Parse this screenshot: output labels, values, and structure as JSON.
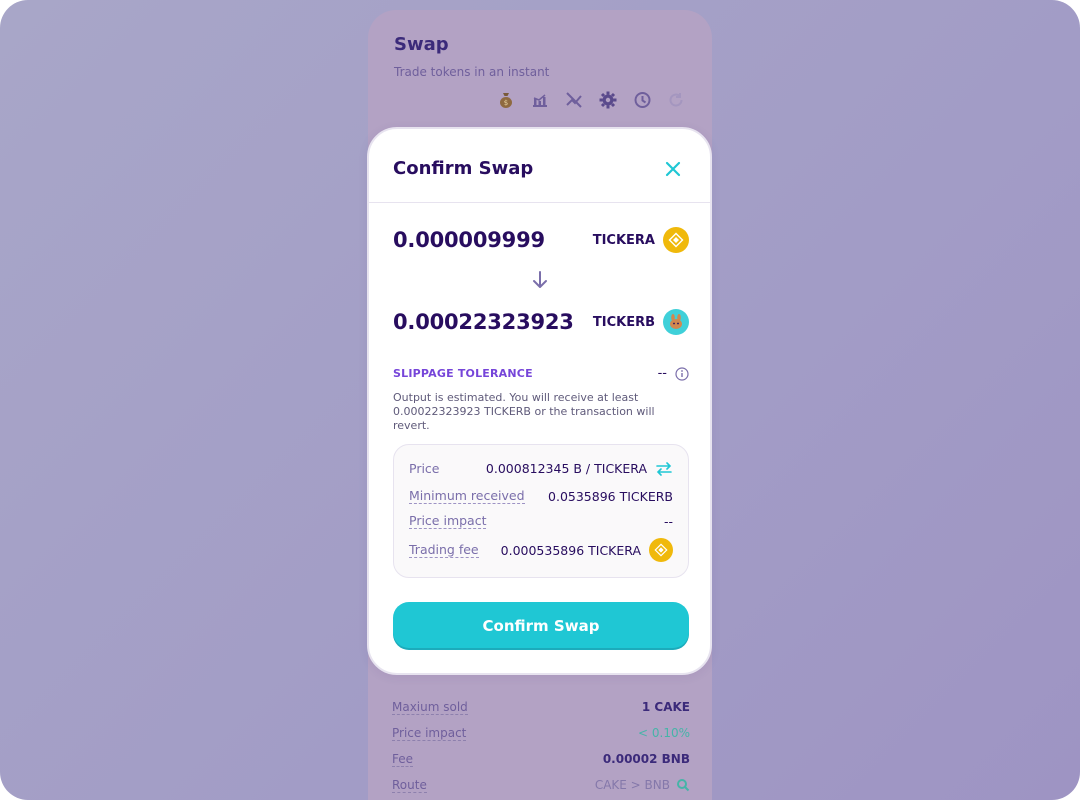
{
  "background": {
    "title": "Swap",
    "subtitle": "Trade tokens in an instant",
    "toolbar_icons": [
      "money-bag-icon",
      "chart-icon",
      "chart-off-icon",
      "gear-icon",
      "history-icon",
      "refresh-icon"
    ],
    "rows": [
      {
        "label": "Maxium sold",
        "value": "1 CAKE"
      },
      {
        "label": "Price impact",
        "value": "< 0.10%"
      },
      {
        "label": "Fee",
        "value": "0.00002 BNB"
      },
      {
        "label": "Route",
        "value": "CAKE > BNB"
      }
    ]
  },
  "modal": {
    "title": "Confirm Swap",
    "from": {
      "amount": "0.000009999",
      "symbol": "TICKERA",
      "icon": "bnb-logo-icon"
    },
    "to": {
      "amount": "0.00022323923",
      "symbol": "TICKERB",
      "icon": "cake-logo-icon"
    },
    "slippage": {
      "label": "SLIPPAGE TOLERANCE",
      "value": "--"
    },
    "note": "Output is estimated. You will receive at least 0.00022323923 TICKERB or the transaction will revert.",
    "details": {
      "price": {
        "label": "Price",
        "value": "0.000812345 B / TICKERA"
      },
      "minimum_received": {
        "label": "Minimum received",
        "value": "0.0535896 TICKERB"
      },
      "price_impact": {
        "label": "Price impact",
        "value": "--"
      },
      "trading_fee": {
        "label": "Trading fee",
        "value": "0.000535896 TICKERA"
      }
    },
    "confirm_label": "Confirm Swap"
  },
  "colors": {
    "primary_text": "#280d5f",
    "accent": "#1fc7d4",
    "secondary": "#7645d9",
    "bnb_yellow": "#f0b90b"
  }
}
